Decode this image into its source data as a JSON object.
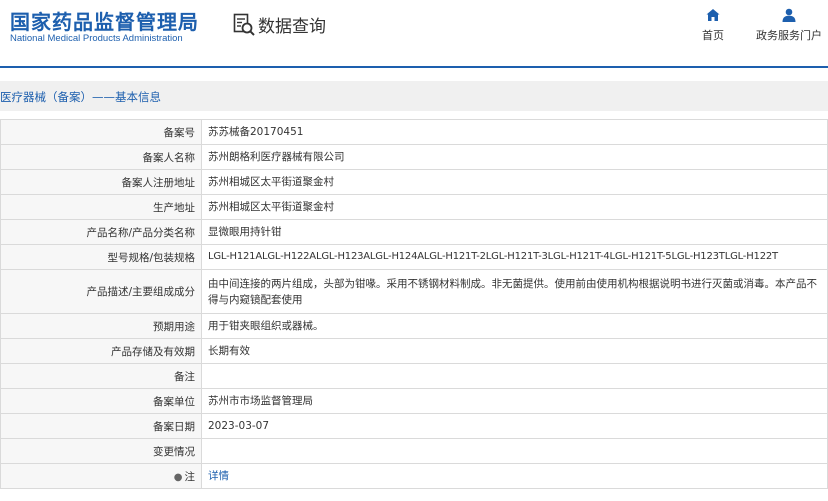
{
  "header": {
    "logo_cn": "国家药品监督管理局",
    "logo_en": "National Medical Products Administration",
    "query_title": "数据查询",
    "nav": {
      "home": "首页",
      "service": "政务服务门户"
    }
  },
  "breadcrumb": "医疗器械（备案）——基本信息",
  "rows": [
    {
      "label": "备案号",
      "value": "苏苏械备20170451"
    },
    {
      "label": "备案人名称",
      "value": "苏州朗格利医疗器械有限公司"
    },
    {
      "label": "备案人注册地址",
      "value": "苏州相城区太平街道聚金村"
    },
    {
      "label": "生产地址",
      "value": "苏州相城区太平街道聚金村"
    },
    {
      "label": "产品名称/产品分类名称",
      "value": "显微眼用持针钳"
    },
    {
      "label": "型号规格/包装规格",
      "value": "LGL-H121ALGL-H122ALGL-H123ALGL-H124ALGL-H121T-2LGL-H121T-3LGL-H121T-4LGL-H121T-5LGL-H123TLGL-H122T"
    },
    {
      "label": "产品描述/主要组成成分",
      "value": "由中间连接的两片组成，头部为钳喙。采用不锈钢材料制成。非无菌提供。使用前由使用机构根据说明书进行灭菌或消毒。本产品不得与内窥镜配套使用"
    },
    {
      "label": "预期用途",
      "value": "用于钳夹眼组织或器械。"
    },
    {
      "label": "产品存储及有效期",
      "value": "长期有效"
    },
    {
      "label": "备注",
      "value": ""
    },
    {
      "label": "备案单位",
      "value": "苏州市市场监督管理局"
    },
    {
      "label": "备案日期",
      "value": "2023-03-07"
    },
    {
      "label": "变更情况",
      "value": ""
    },
    {
      "label": "注",
      "value": "详情"
    }
  ],
  "colors": {
    "brand": "#1d5fae",
    "label_bg": "#f7f7f7",
    "crumb_bg": "#f0f0f0"
  },
  "icons": {
    "query": "search-document-icon",
    "home": "home-icon",
    "service": "user-icon",
    "note": "location-pin-icon"
  }
}
